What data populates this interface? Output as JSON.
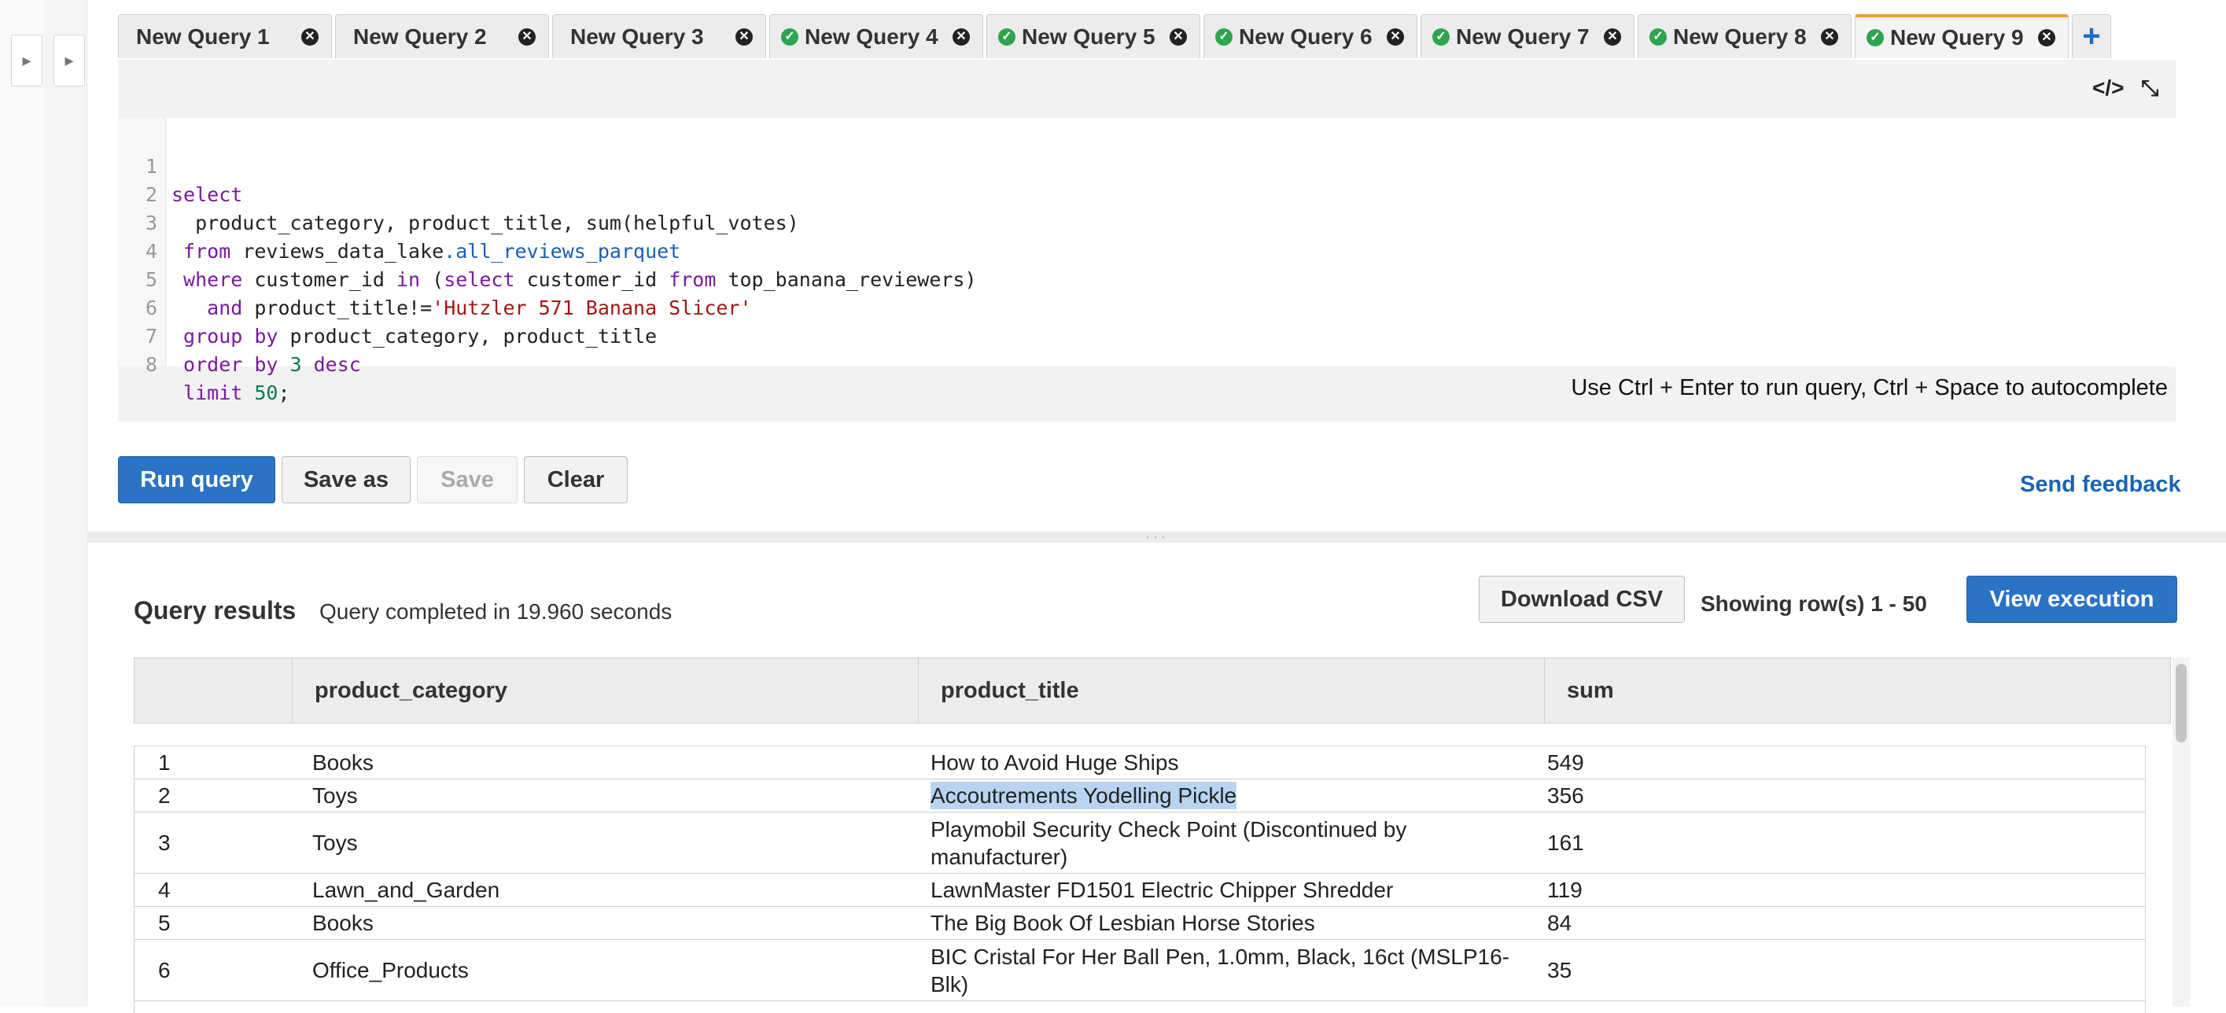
{
  "rails": {
    "left_toggle": "▸",
    "second_toggle": "▸"
  },
  "tabs": [
    {
      "label": "New Query 1",
      "status": "none"
    },
    {
      "label": "New Query 2",
      "status": "none"
    },
    {
      "label": "New Query 3",
      "status": "none"
    },
    {
      "label": "New Query 4",
      "status": "success"
    },
    {
      "label": "New Query 5",
      "status": "success"
    },
    {
      "label": "New Query 6",
      "status": "success"
    },
    {
      "label": "New Query 7",
      "status": "success"
    },
    {
      "label": "New Query 8",
      "status": "success"
    },
    {
      "label": "New Query 9",
      "status": "success",
      "active": true
    }
  ],
  "tab_close_glyph": "✕",
  "tab_success_glyph": "✓",
  "tab_add_glyph": "+",
  "editor": {
    "format_icon": "</>",
    "minimize_icon": "⤡",
    "line_numbers": [
      "1",
      "2",
      "3",
      "4",
      "5",
      "6",
      "7",
      "8"
    ],
    "hint": "Use Ctrl + Enter to run query, Ctrl + Space to autocomplete"
  },
  "code_tokens": {
    "l1_kw": "select",
    "l2_text": "  product_category, product_title, sum(helpful_votes)",
    "l3_kw": " from",
    "l3_text": " reviews_data_lake",
    "l3_tbl": ".all_reviews_parquet",
    "l4_kw1": " where",
    "l4_text1": " customer_id ",
    "l4_kw2": "in",
    "l4_text2": " (",
    "l4_kw3": "select",
    "l4_text3": " customer_id ",
    "l4_kw4": "from",
    "l4_text4": " top_banana_reviewers)",
    "l5_kw": "   and",
    "l5_text": " product_title!=",
    "l5_str": "'Hutzler 571 Banana Slicer'",
    "l6_kw": " group by",
    "l6_text": " product_category, product_title",
    "l7_kw": " order by",
    "l7_num": " 3",
    "l7_kw2": " desc",
    "l8_kw": " limit",
    "l8_num": " 50",
    "l8_text": ";"
  },
  "actions": {
    "run": "Run query",
    "save_as": "Save as",
    "save": "Save",
    "clear": "Clear",
    "feedback": "Send feedback"
  },
  "results": {
    "title": "Query results",
    "status": "Query completed in 19.960 seconds",
    "download": "Download CSV",
    "showing": "Showing row(s) 1 - 50",
    "view_execution": "View execution",
    "columns": [
      "",
      "product_category",
      "product_title",
      "sum"
    ],
    "rows": [
      {
        "n": "1",
        "category": "Books",
        "title": "How to Avoid Huge Ships",
        "sum": "549"
      },
      {
        "n": "2",
        "category": "Toys",
        "title": "Accoutrements Yodelling Pickle",
        "sum": "356",
        "selected": true
      },
      {
        "n": "3",
        "category": "Toys",
        "title": "Playmobil Security Check Point (Discontinued by manufacturer)",
        "sum": "161"
      },
      {
        "n": "4",
        "category": "Lawn_and_Garden",
        "title": "LawnMaster FD1501 Electric Chipper Shredder",
        "sum": "119"
      },
      {
        "n": "5",
        "category": "Books",
        "title": "The Big Book Of Lesbian Horse Stories",
        "sum": "84"
      },
      {
        "n": "6",
        "category": "Office_Products",
        "title": "BIC Cristal For Her Ball Pen, 1.0mm, Black, 16ct (MSLP16-Blk)",
        "sum": "35"
      }
    ]
  }
}
